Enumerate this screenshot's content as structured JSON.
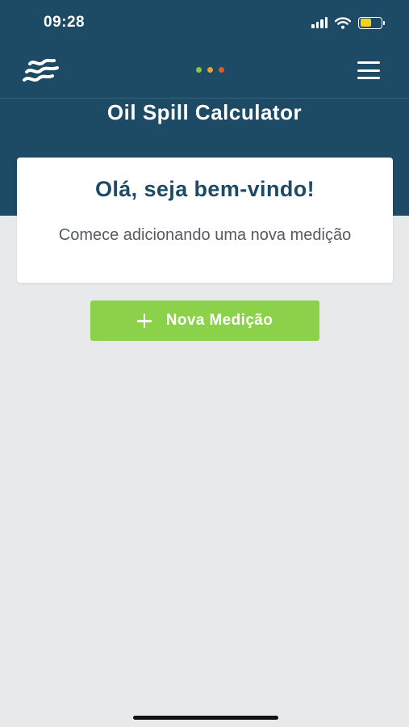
{
  "status_bar": {
    "time": "09:28",
    "signal_icon": "cellular-signal-icon",
    "wifi_icon": "wifi-icon",
    "battery_icon": "battery-icon",
    "battery_level": 0.55,
    "battery_color": "#f2d21b"
  },
  "nav": {
    "logo_icon": "wave-logo-icon",
    "menu_icon": "hamburger-menu-icon",
    "page_dots": [
      "#8cc63f",
      "#f0a030",
      "#e4572e"
    ]
  },
  "header": {
    "title": "Oil Spill Calculator"
  },
  "welcome": {
    "title": "Olá, seja bem-vindo!",
    "subtitle": "Comece adicionando uma nova medição"
  },
  "actions": {
    "new_measure_label": "Nova Medição",
    "new_measure_icon": "plus-icon"
  },
  "colors": {
    "header_bg": "#1d4a64",
    "page_bg": "#e8e9eb",
    "accent_green": "#8cd14a",
    "title_blue": "#1d4a64"
  }
}
